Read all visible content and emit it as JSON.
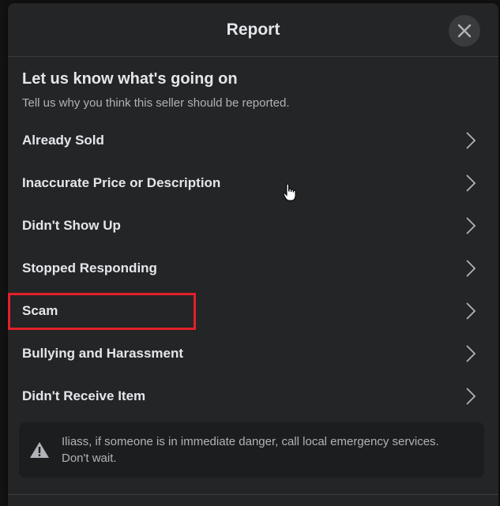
{
  "dialog": {
    "title": "Report",
    "close_icon": "close-icon"
  },
  "intro": {
    "heading": "Let us know what's going on",
    "subtext": "Tell us why you think this seller should be reported."
  },
  "options": [
    {
      "label": "Already Sold",
      "icon": "chevron-right-icon"
    },
    {
      "label": "Inaccurate Price or Description",
      "icon": "chevron-right-icon"
    },
    {
      "label": "Didn't Show Up",
      "icon": "chevron-right-icon"
    },
    {
      "label": "Stopped Responding",
      "icon": "chevron-right-icon"
    },
    {
      "label": "Scam",
      "icon": "chevron-right-icon",
      "highlighted": true
    },
    {
      "label": "Bullying and Harassment",
      "icon": "chevron-right-icon"
    },
    {
      "label": "Didn't Receive Item",
      "icon": "chevron-right-icon"
    }
  ],
  "notice": {
    "icon": "warning-icon",
    "text": "Iliass, if someone is in immediate danger, call local emergency services. Don't wait."
  },
  "colors": {
    "background": "#242526",
    "text_primary": "#e4e6eb",
    "text_secondary": "#b0b3b8",
    "highlight": "#e2202a"
  }
}
